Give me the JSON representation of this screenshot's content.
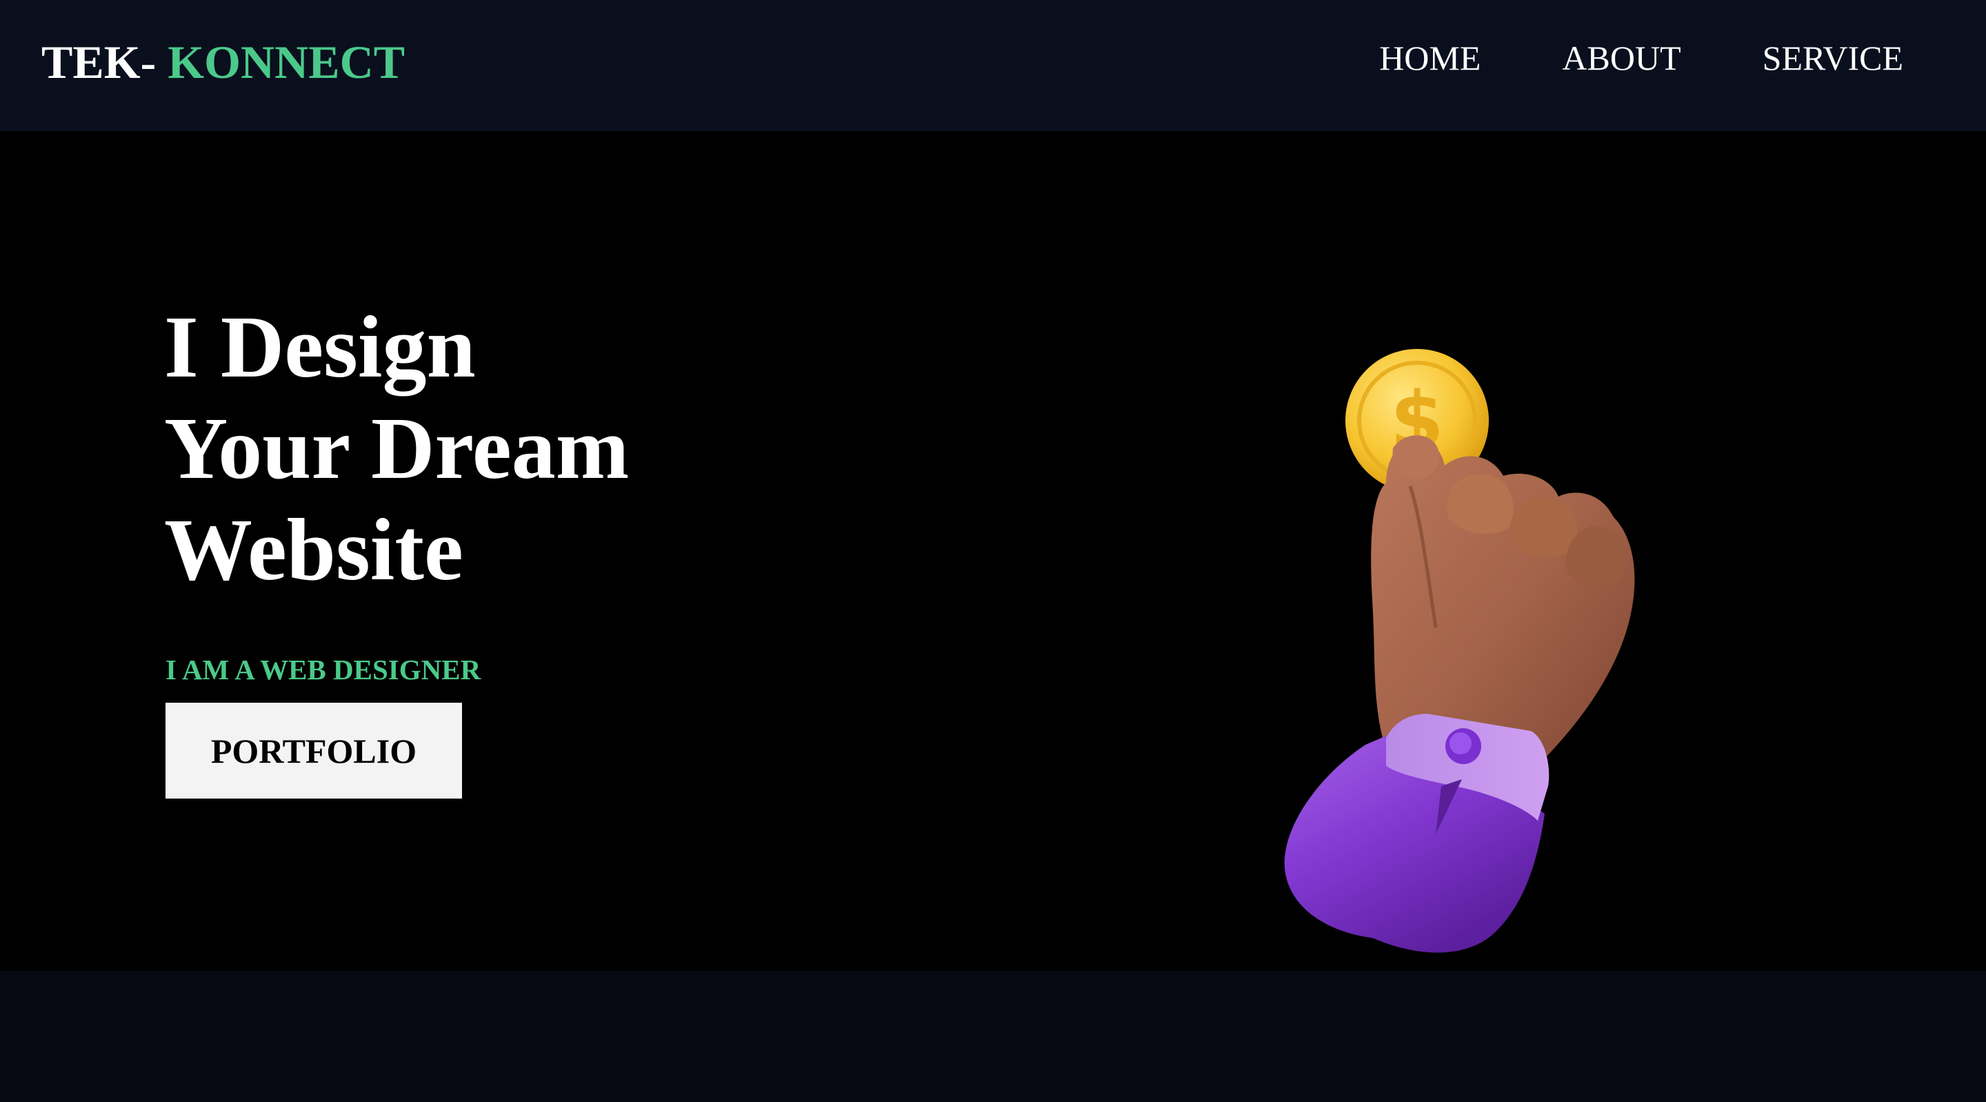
{
  "header": {
    "logo": {
      "part_a": "TEK- ",
      "part_b": "KONNECT"
    },
    "nav": [
      "HOME",
      "ABOUT",
      "SERVICE"
    ]
  },
  "hero": {
    "headline": [
      "I Design",
      "Your Dream",
      "Website"
    ],
    "tagline": "I AM A WEB DESIGNER",
    "button_label": "PORTFOLIO",
    "illustration": "hand-holding-coin-icon"
  },
  "colors": {
    "nav_bg": "#0a0f1e",
    "hero_bg": "#000000",
    "accent": "#4bc98a",
    "button_bg": "#f3f3f3",
    "footer_bg": "#060912"
  }
}
